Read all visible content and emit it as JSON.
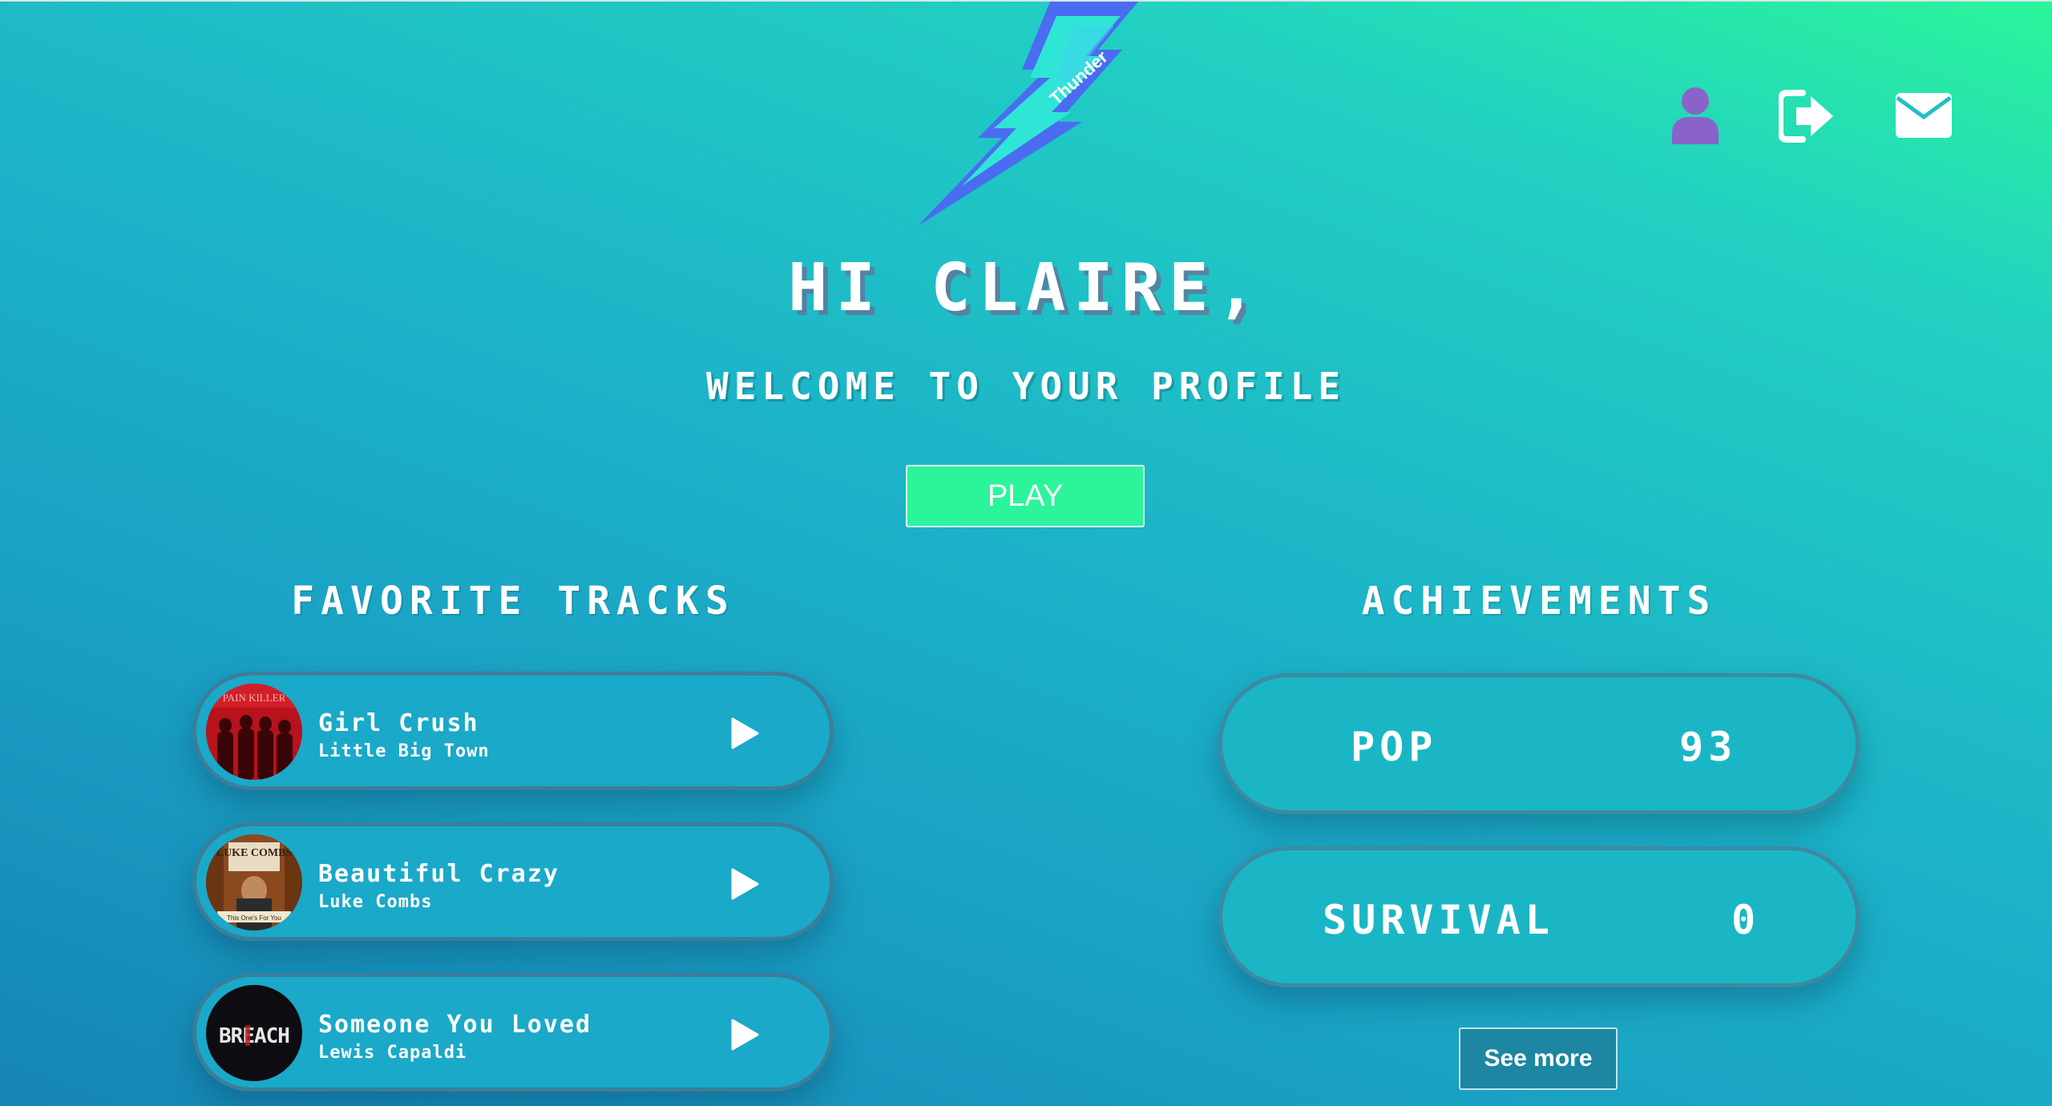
{
  "logo": {
    "text": "Thunder",
    "icon": "lightning-bolt-logo"
  },
  "header_icons": [
    {
      "name": "user-icon",
      "color": "#8a63c9"
    },
    {
      "name": "logout-icon",
      "color": "#ffffff"
    },
    {
      "name": "mail-icon",
      "color": "#ffffff"
    }
  ],
  "greeting": {
    "title": "HI CLAIRE,",
    "subtitle": "WELCOME TO YOUR PROFILE"
  },
  "play_button": {
    "label": "PLAY",
    "color": "#2cf49a"
  },
  "favorites": {
    "title": "FAVORITE TRACKS",
    "tracks": [
      {
        "title": "Girl Crush",
        "artist": "Little Big Town"
      },
      {
        "title": "Beautiful Crazy",
        "artist": "Luke Combs"
      },
      {
        "title": "Someone You Loved",
        "artist": "Lewis Capaldi"
      }
    ]
  },
  "achievements": {
    "title": "ACHIEVEMENTS",
    "items": [
      {
        "label": "POP",
        "value": "93"
      },
      {
        "label": "SURVIVAL",
        "value": "0"
      }
    ],
    "see_more_label": "See more"
  },
  "album_art": {
    "track_1_text": "PAIN KILLER",
    "track_2_text": "LUKE COMBS",
    "track_2_subtext": "This One's For You",
    "track_3_text": "BREACH"
  },
  "colors": {
    "gradient_top_right": "#2bf59a",
    "gradient_bottom_left": "#1585b4",
    "logo_bolt_outer": "#4a6cf0",
    "logo_bolt_inner": "#2fe6d6"
  }
}
